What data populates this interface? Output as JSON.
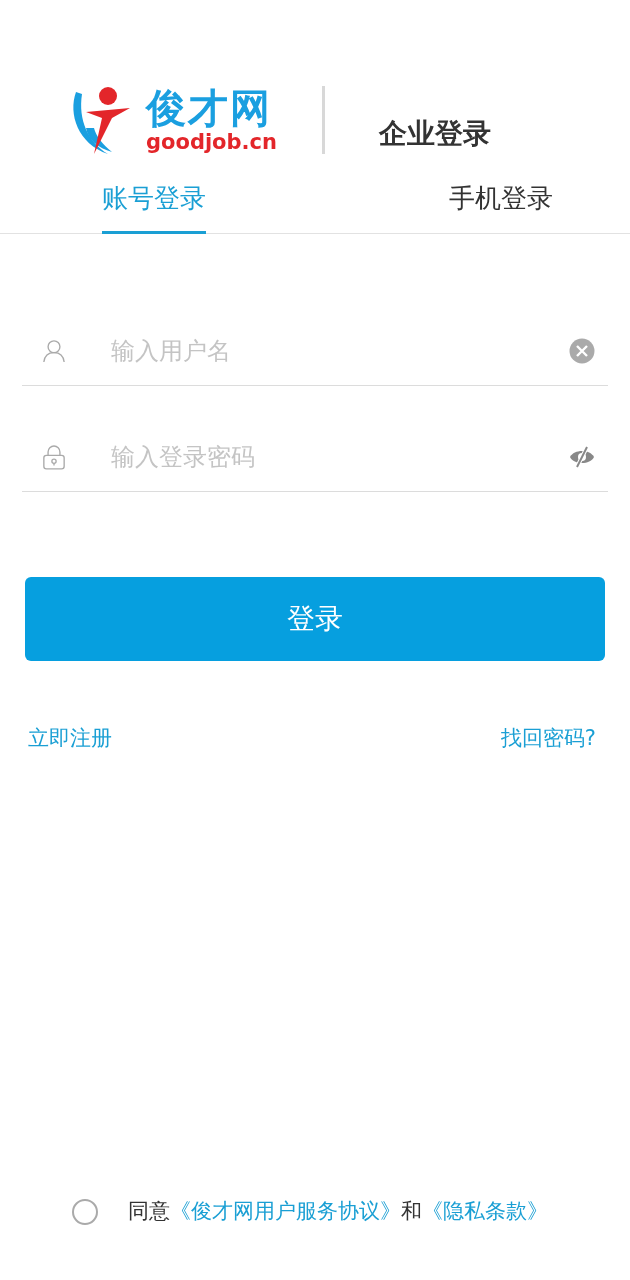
{
  "logo": {
    "name": "俊才网",
    "domain": "goodjob.cn"
  },
  "page_title": "企业登录",
  "tabs": [
    {
      "label": "账号登录",
      "selected": true
    },
    {
      "label": "手机登录",
      "selected": false
    }
  ],
  "fields": [
    {
      "kind": "username",
      "placeholder": "输入用户名"
    },
    {
      "kind": "password",
      "placeholder": "输入登录密码"
    }
  ],
  "login_button": "登录",
  "links": {
    "register": "立即注册",
    "forgot_password": "找回密码?"
  },
  "agreement": {
    "checked": false,
    "prefix": "同意",
    "terms": "《俊才网用户服务协议》",
    "and": "和",
    "privacy": "《隐私条款》"
  }
}
